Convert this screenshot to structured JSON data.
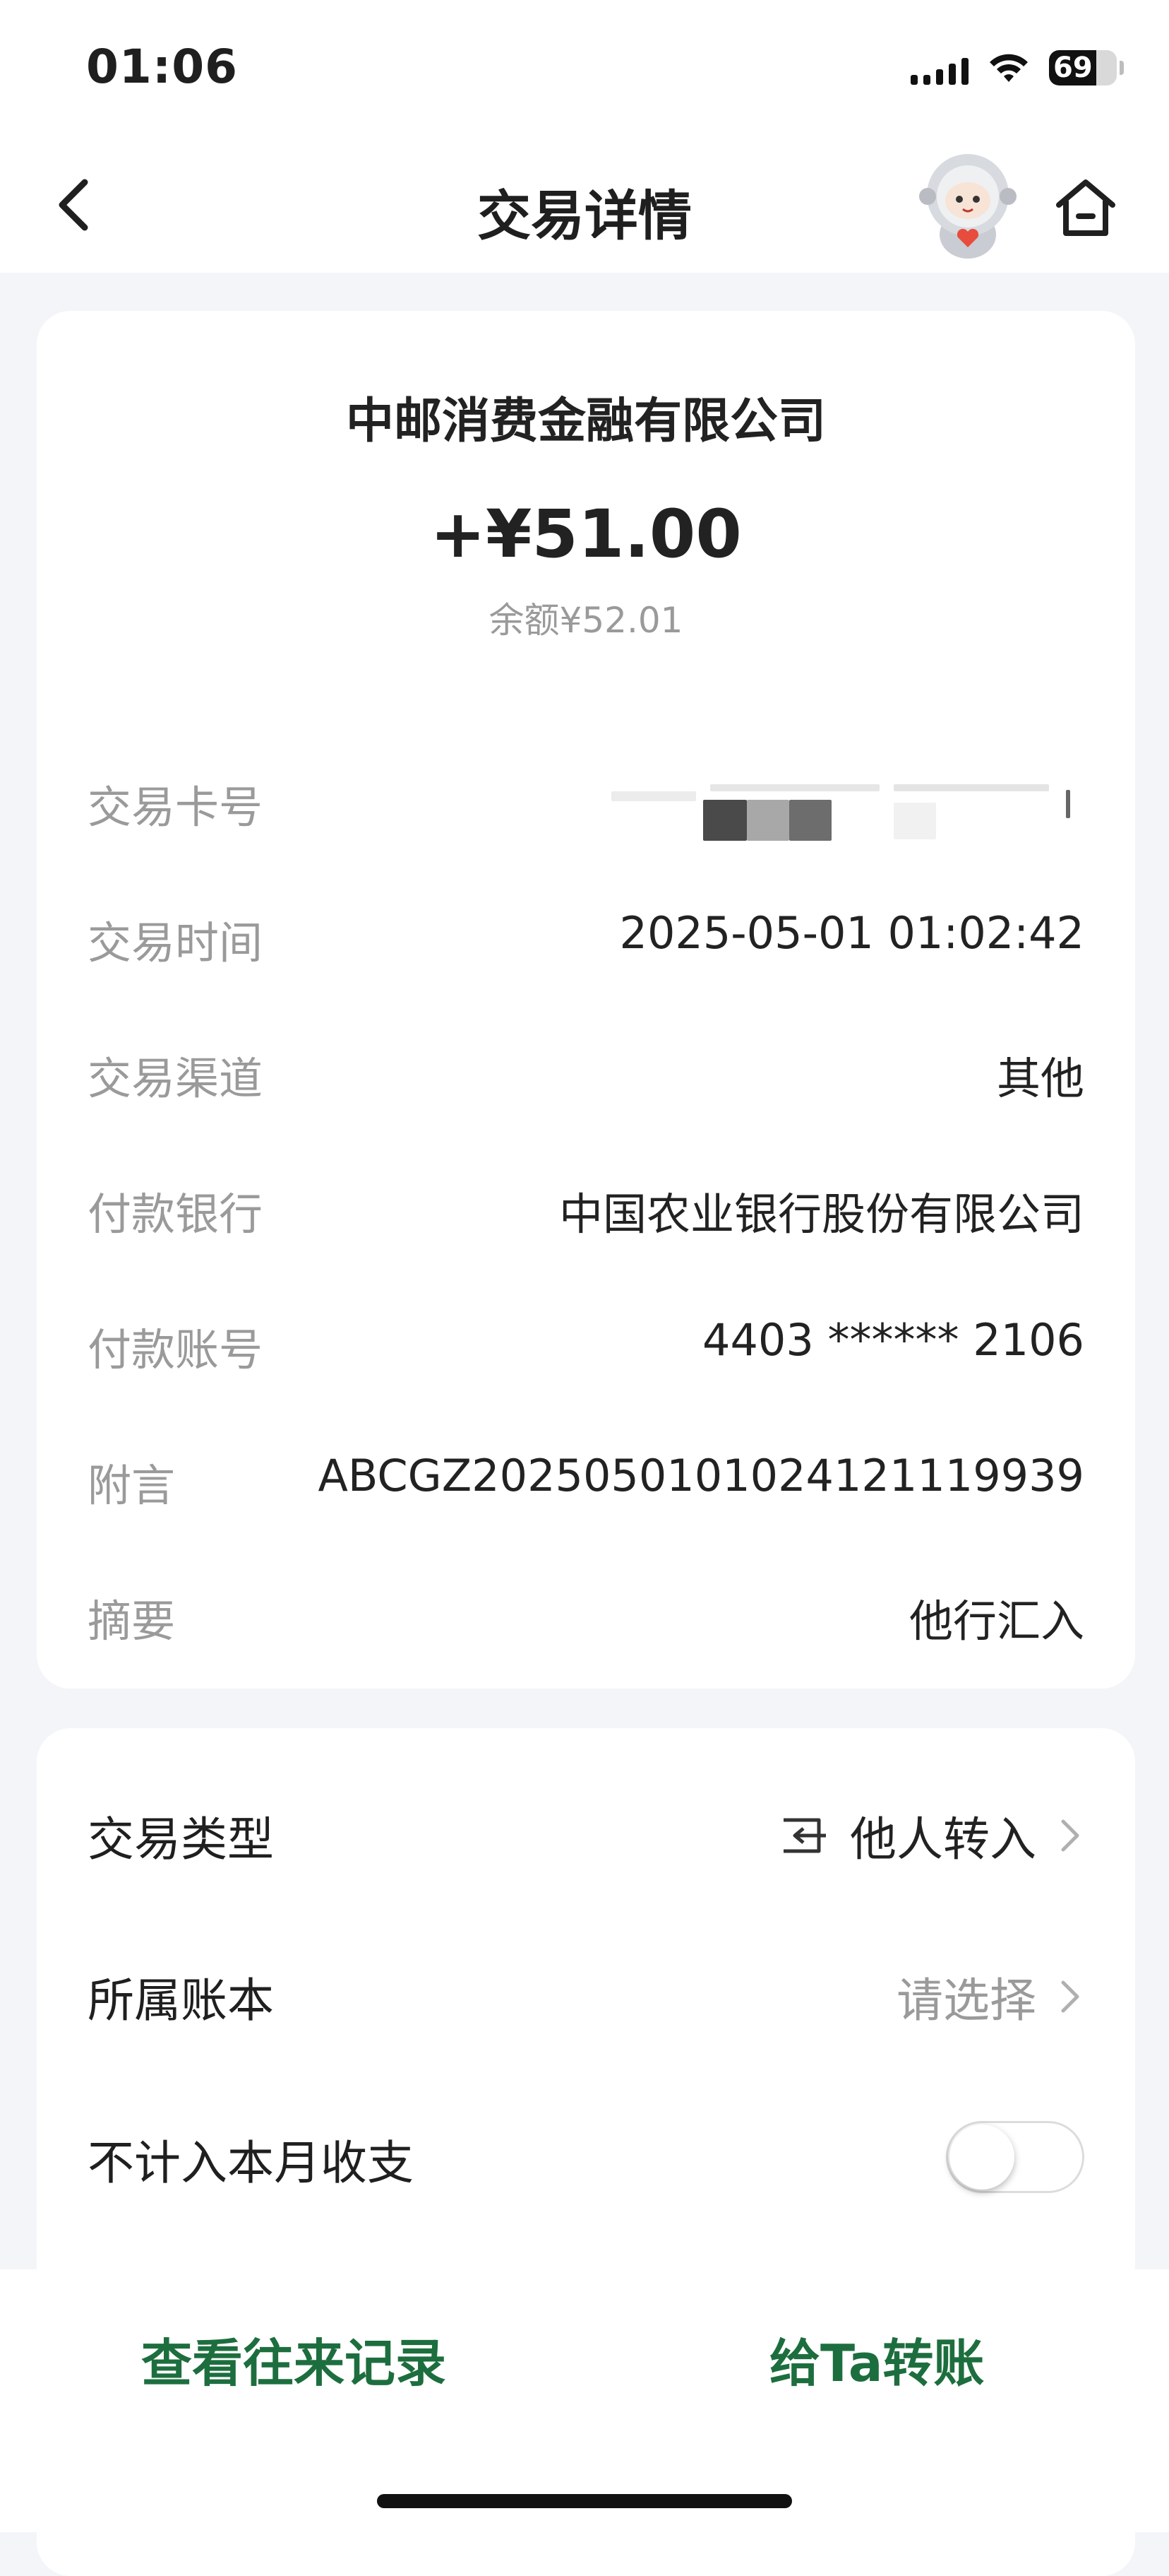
{
  "status_bar": {
    "time": "01:06",
    "battery": "69",
    "battery_level": 0.69
  },
  "nav": {
    "title": "交易详情",
    "back_icon": "chevron-left-icon",
    "home_icon": "home-icon",
    "mascot": "astronaut-mascot"
  },
  "summary": {
    "payee": "中邮消费金融有限公司",
    "amount": "+¥51.00",
    "balance": "余额¥52.01"
  },
  "details": [
    {
      "label": "交易卡号",
      "value": ""
    },
    {
      "label": "交易时间",
      "value": "2025-05-01 01:02:42"
    },
    {
      "label": "交易渠道",
      "value": "其他"
    },
    {
      "label": "付款银行",
      "value": "中国农业银行股份有限公司"
    },
    {
      "label": "付款账号",
      "value": "4403 ****** 2106"
    },
    {
      "label": "附言",
      "value": "ABCGZ2025050101024121119939"
    },
    {
      "label": "摘要",
      "value": "他行汇入"
    }
  ],
  "options": {
    "transaction_type": {
      "label": "交易类型",
      "value": "他人转入",
      "icon": "transfer-in-icon"
    },
    "ledger": {
      "label": "所属账本",
      "value": "请选择"
    },
    "exclude_monthly": {
      "label": "不计入本月收支",
      "enabled": false
    }
  },
  "actions": {
    "view_history": "查看往来记录",
    "transfer_to": "给Ta转账"
  },
  "colors": {
    "accent": "#1d6e3e",
    "muted": "#9a9a9a",
    "background": "#f4f5f9"
  }
}
